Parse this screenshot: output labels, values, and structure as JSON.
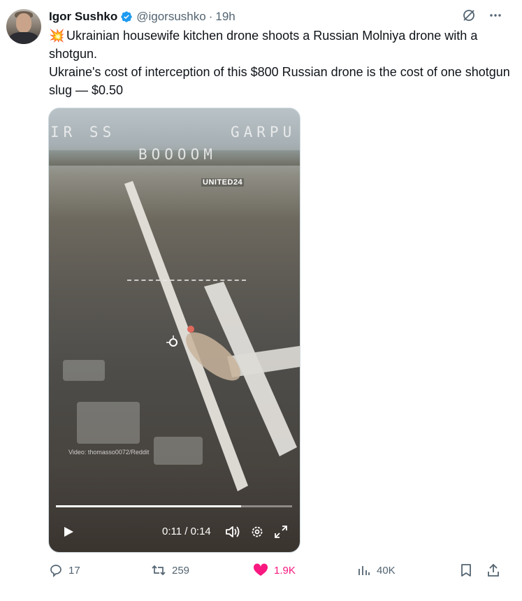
{
  "tweet": {
    "author_name": "Igor Sushko",
    "handle": "@igorsushko",
    "separator": "·",
    "time": "19h",
    "emoji": "💥",
    "line1": " Ukrainian housewife kitchen drone shoots a Russian Molniya drone with a shotgun.",
    "line2": "Ukraine's cost of interception of this $800 Russian drone is the cost of one shotgun slug — $0.50"
  },
  "video": {
    "overlay_top_left": "IR SS",
    "overlay_top_right": "GARPU",
    "overlay_boom": "BOOOOM",
    "brand": "UNITED24",
    "credit": "Video: thomasso0072/Reddit",
    "time_display": "0:11 / 0:14",
    "progress_fraction": 0.785
  },
  "actions": {
    "replies": "17",
    "reposts": "259",
    "likes": "1.9K",
    "views": "40K"
  },
  "colors": {
    "verified": "#1d9bf0",
    "like": "#f91880",
    "muted": "#536471"
  }
}
